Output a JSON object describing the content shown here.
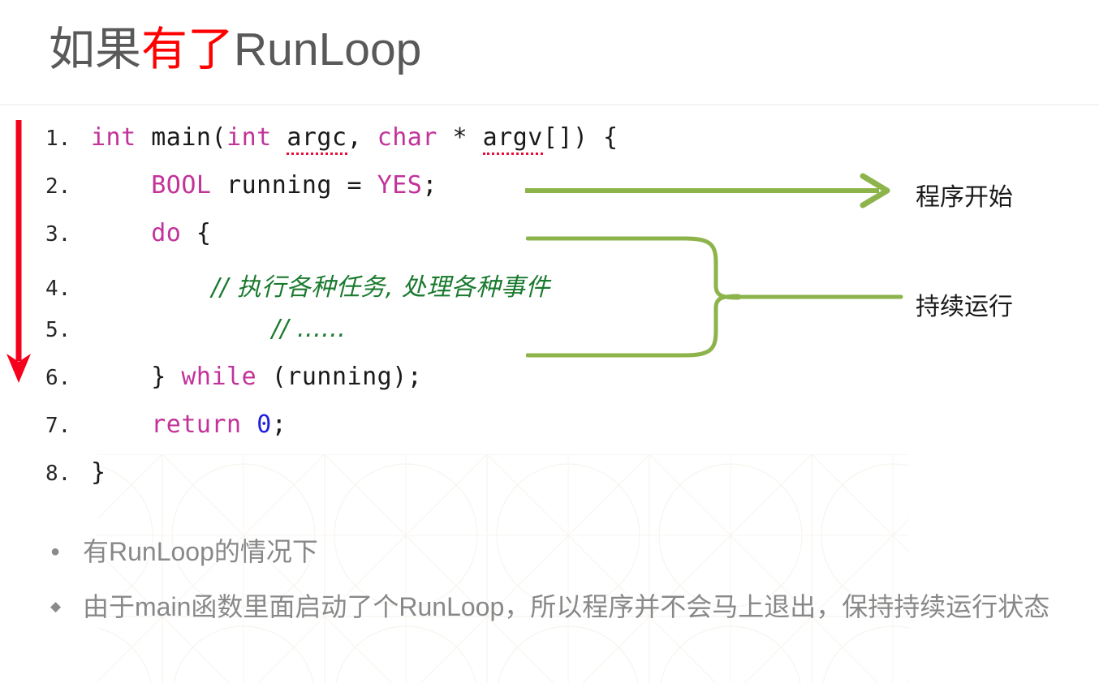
{
  "slide": {
    "title_prefix": "如果",
    "title_highlight": "有了",
    "title_suffix": "RunLoop",
    "highlight_color": "#ff0000",
    "title_color": "#595959"
  },
  "code": {
    "language": "objective-c",
    "lines": [
      {
        "no": "1.",
        "indent": 0,
        "tokens": [
          {
            "t": "int",
            "c": "kw"
          },
          {
            "t": " main(",
            "c": "plain"
          },
          {
            "t": "int",
            "c": "kw"
          },
          {
            "t": " ",
            "c": "plain"
          },
          {
            "t": "argc",
            "c": "spell"
          },
          {
            "t": ", ",
            "c": "plain"
          },
          {
            "t": "char",
            "c": "kw"
          },
          {
            "t": " * ",
            "c": "plain"
          },
          {
            "t": "argv",
            "c": "spell"
          },
          {
            "t": "[]) {",
            "c": "plain"
          }
        ]
      },
      {
        "no": "2.",
        "indent": 1,
        "tokens": [
          {
            "t": "BOOL",
            "c": "kw"
          },
          {
            "t": " running = ",
            "c": "plain"
          },
          {
            "t": "YES",
            "c": "kw"
          },
          {
            "t": ";",
            "c": "plain"
          }
        ]
      },
      {
        "no": "3.",
        "indent": 1,
        "tokens": [
          {
            "t": "do",
            "c": "kw"
          },
          {
            "t": " {",
            "c": "plain"
          }
        ]
      },
      {
        "no": "4.",
        "indent": 2,
        "tokens": [
          {
            "t": "// 执行各种任务, 处理各种事件",
            "c": "cmt"
          }
        ]
      },
      {
        "no": "5.",
        "indent": 3,
        "tokens": [
          {
            "t": "// ......",
            "c": "cmt"
          }
        ]
      },
      {
        "no": "6.",
        "indent": 1,
        "tokens": [
          {
            "t": "} ",
            "c": "plain"
          },
          {
            "t": "while",
            "c": "kw"
          },
          {
            "t": " (running);",
            "c": "plain"
          }
        ]
      },
      {
        "no": "7.",
        "indent": 1,
        "tokens": [
          {
            "t": "return",
            "c": "kw"
          },
          {
            "t": " ",
            "c": "plain"
          },
          {
            "t": "0",
            "c": "num"
          },
          {
            "t": ";",
            "c": "plain"
          }
        ]
      },
      {
        "no": "8.",
        "indent": 0,
        "tokens": [
          {
            "t": "}",
            "c": "plain"
          }
        ]
      }
    ],
    "colors": {
      "keyword": "#c2339a",
      "number": "#2020dd",
      "comment": "#1a7a2e",
      "plain": "#1a1a1a",
      "line_number": "#262626",
      "spellcheck_underline": "#e8113c"
    }
  },
  "annotations": {
    "flow_arrow_color": "#ff0000",
    "marker_color": "#8cb44a",
    "program_start": "程序开始",
    "keep_running": "持续运行"
  },
  "bullets": [
    {
      "marker": "●",
      "level": 1,
      "text": "有RunLoop的情况下"
    },
    {
      "marker": "◆",
      "level": 2,
      "text": "由于main函数里面启动了个RunLoop，所以程序并不会马上退出，保持持续运行状态"
    }
  ]
}
